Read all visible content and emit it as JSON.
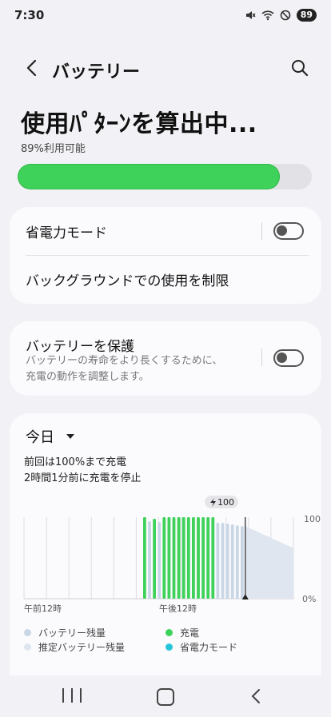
{
  "status_bar": {
    "time": "7:30",
    "battery": "89",
    "icons": [
      "mute-icon",
      "wifi-icon",
      "dnd-icon"
    ]
  },
  "header": {
    "title": "バッテリー",
    "back_icon": "back-arrow-icon",
    "search_icon": "search-icon"
  },
  "hero": {
    "title": "使用ﾊﾟﾀｰﾝを算出中...",
    "subtitle": "89%利用可能",
    "level_percent": 89,
    "fill_color": "#3fd25a"
  },
  "power_saving": {
    "label": "省電力モード",
    "enabled": false
  },
  "background_limit": {
    "label": "バックグラウンドでの使用を制限"
  },
  "protect": {
    "title": "バッテリーを保護",
    "desc_line1": "バッテリーの寿命をより長くするために、",
    "desc_line2": "充電の動作を調整します。",
    "enabled": false
  },
  "usage": {
    "period_label": "今日",
    "line1": "前回は100%まで充電",
    "line2": "2時間1分前に充電を停止",
    "marker": "100",
    "y_top": "100",
    "y_bottom": "0%",
    "x_start": "午前12時",
    "x_mid": "午後12時"
  },
  "legend": {
    "remaining": "バッテリー残量",
    "estimated": "推定バッテリー残量",
    "charging": "充電",
    "saving": "省電力モード"
  },
  "colors": {
    "accent_green": "#3fd25a",
    "remaining": "#c9d6e6",
    "estimated": "#dfe6ef",
    "saving": "#26c6da"
  },
  "chart_data": {
    "type": "bar",
    "ylim": [
      0,
      100
    ],
    "ylabel_ticks": [
      "0%",
      "100"
    ],
    "x_labels": [
      "午前12時",
      "午後12時"
    ],
    "charging_levels": [
      100,
      98,
      100,
      100,
      100,
      100,
      100,
      100,
      100,
      100,
      100,
      100,
      100
    ],
    "remaining_levels": [
      95,
      94,
      93,
      93,
      92,
      91,
      90,
      89
    ],
    "estimated_range": [
      89,
      62
    ]
  },
  "navbar": {
    "recents_icon": "recents-icon",
    "home_icon": "home-icon",
    "back_icon": "nav-back-icon"
  }
}
